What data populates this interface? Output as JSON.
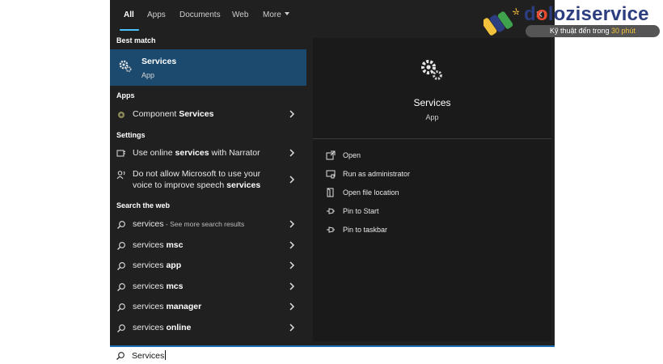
{
  "tabs": [
    "All",
    "Apps",
    "Documents",
    "Web",
    "More"
  ],
  "close_glyph": "✕",
  "sections": {
    "best_match": "Best match",
    "apps": "Apps",
    "settings": "Settings",
    "search_web": "Search the web"
  },
  "best_match": {
    "title": "Services",
    "type": "App",
    "icon": "services-gear-icon"
  },
  "apps": [
    {
      "pre": "Component ",
      "bold": "Services",
      "icon": "component-services-icon"
    }
  ],
  "settings": [
    {
      "line1_pre": "Use online ",
      "line1_bold": "services",
      "line1_post": " with Narrator",
      "icon": "narrator-icon"
    },
    {
      "line1_pre": "Do not allow Microsoft to use your",
      "line2_pre": "voice to improve speech ",
      "line2_bold": "services",
      "icon": "speech-icon"
    }
  ],
  "web": [
    {
      "pre": "services",
      "bold": "",
      "small": " - See more search results"
    },
    {
      "pre": "services ",
      "bold": "msc"
    },
    {
      "pre": "services ",
      "bold": "app"
    },
    {
      "pre": "services ",
      "bold": "mcs"
    },
    {
      "pre": "services ",
      "bold": "manager"
    },
    {
      "pre": "services ",
      "bold": "online"
    }
  ],
  "detail": {
    "title": "Services",
    "type": "App",
    "actions": [
      {
        "label": "Open",
        "icon": "open-icon"
      },
      {
        "label": "Run as administrator",
        "icon": "run-as-admin-icon"
      },
      {
        "label": "Open file location",
        "icon": "file-location-icon"
      },
      {
        "label": "Pin to Start",
        "icon": "pin-icon"
      },
      {
        "label": "Pin to taskbar",
        "icon": "pin-icon"
      }
    ]
  },
  "search": {
    "value": "Services"
  },
  "watermark": {
    "brand_o": "d",
    "brand_mid": "o",
    "brand_rest": "loziservice",
    "tagline_pre": "Kỹ thuật đến trong ",
    "tagline_hl": "30 phút"
  },
  "colors": {
    "panel": "#202020",
    "selected": "#1c4a6e",
    "accent": "#4cc2ff",
    "searchbar_border": "#1e6fb5"
  }
}
